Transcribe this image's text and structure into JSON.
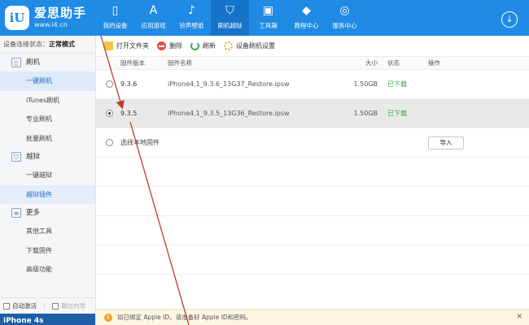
{
  "app": {
    "logo_badge": "iU",
    "logo_name": "爱思助手",
    "logo_url": "www.i4.cn"
  },
  "nav": [
    {
      "label": "我的设备",
      "icon": "phone-icon"
    },
    {
      "label": "应用游戏",
      "icon": "app-store-icon"
    },
    {
      "label": "铃声壁纸",
      "icon": "music-wallpaper-icon"
    },
    {
      "label": "刷机越狱",
      "icon": "flash-jailbreak-icon",
      "active": true
    },
    {
      "label": "工具箱",
      "icon": "toolbox-icon"
    },
    {
      "label": "教程中心",
      "icon": "graduation-cap-icon"
    },
    {
      "label": "服务中心",
      "icon": "compass-icon"
    }
  ],
  "sidebar": {
    "status_label": "设备连接状态：",
    "status_value": "正常模式",
    "groups": [
      {
        "label": "刷机",
        "icon": "phone-icon",
        "items": [
          "一键刷机",
          "iTunes刷机",
          "专业刷机",
          "批量刷机"
        ]
      },
      {
        "label": "越狱",
        "icon": "shield-icon",
        "items": [
          "一键越狱",
          "越狱插件"
        ]
      },
      {
        "label": "更多",
        "icon": "menu-icon",
        "items": [
          "其他工具",
          "下载固件",
          "高级功能"
        ]
      }
    ],
    "active_item": "一键刷机",
    "auto_activate": "自动激活",
    "skip_guide": "跳过向导",
    "device_name": "iPhone 4s"
  },
  "toolbar": {
    "open_folder": "打开文件夹",
    "delete": "删除",
    "refresh": "刷新",
    "settings": "设备刷机设置"
  },
  "table": {
    "headers": {
      "version": "固件版本",
      "name": "固件名称",
      "size": "大小",
      "status": "状态",
      "operation": "操作"
    },
    "rows": [
      {
        "version": "9.3.6",
        "name": "iPhone4,1_9.3.6_13G37_Restore.ipsw",
        "size": "1.50GB",
        "status": "已下载",
        "selected": false
      },
      {
        "version": "9.3.5",
        "name": "iPhone4,1_9.3.5_13G36_Restore.ipsw",
        "size": "1.50GB",
        "status": "已下载",
        "selected": true
      }
    ],
    "local_firmware": "选择本地固件",
    "import_button": "导入"
  },
  "notice": {
    "text": "如已绑定 Apple ID，请准备好 Apple ID和密码。",
    "icon": "warning-icon"
  },
  "colors": {
    "brand": "#1f8be5",
    "status_ok": "#3aa34a",
    "annotation": "#c0392b"
  }
}
